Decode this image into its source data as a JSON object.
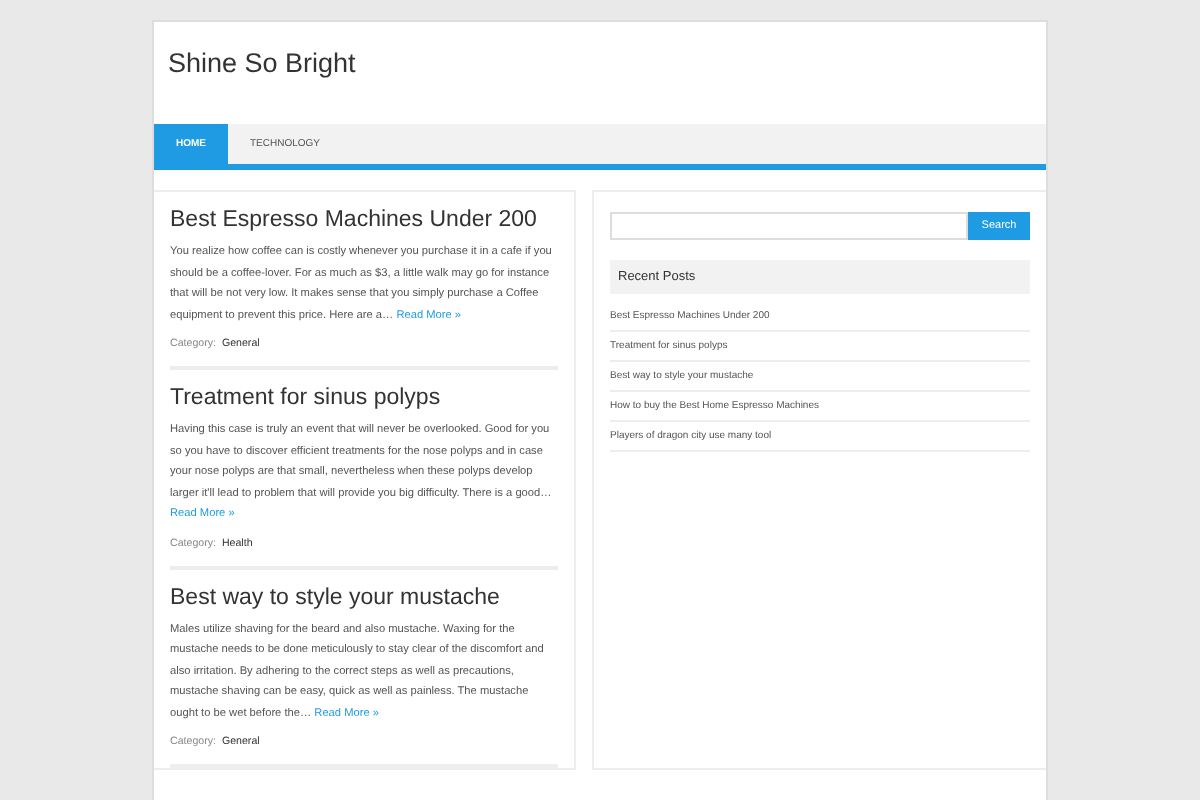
{
  "site_title": "Shine So Bright",
  "nav": [
    {
      "label": "HOME",
      "selected": true
    },
    {
      "label": "TECHNOLOGY",
      "selected": false
    }
  ],
  "posts": [
    {
      "title": "Best Espresso Machines Under 200",
      "excerpt": "You realize how coffee can is costly whenever you purchase it in a cafe if you should be a coffee-lover. For as much as $3, a little walk may go for instance that will be not very low. It makes sense that you simply purchase a Coffee equipment to prevent this price. Here are a…",
      "read_more": "Read More »",
      "category_label": "Category:",
      "category": "General"
    },
    {
      "title": "Treatment for sinus polyps",
      "excerpt": "Having this case is truly an event that will never be overlooked. Good for you so you have to discover efficient treatments for the nose polyps and in case your nose polyps are that small, nevertheless when these polyps develop larger it'll lead to problem that will provide you big difficulty. There is a good…",
      "read_more": "Read More »",
      "category_label": "Category:",
      "category": "Health"
    },
    {
      "title": "Best way to style your mustache",
      "excerpt": "Males utilize shaving for the beard and also mustache. Waxing for the mustache needs to be done meticulously to stay clear of the discomfort and also irritation. By adhering to the correct steps as well as precautions, mustache shaving can be easy, quick as well as painless. The mustache ought to be wet before the…",
      "read_more": "Read More »",
      "category_label": "Category:",
      "category": "General"
    }
  ],
  "sidebar": {
    "search_button": "Search",
    "recent_title": "Recent Posts",
    "recent_posts": [
      "Best Espresso Machines Under 200",
      "Treatment for sinus polyps",
      "Best way to style your mustache",
      "How to buy the Best Home Espresso Machines",
      "Players of dragon city use many tool"
    ]
  }
}
